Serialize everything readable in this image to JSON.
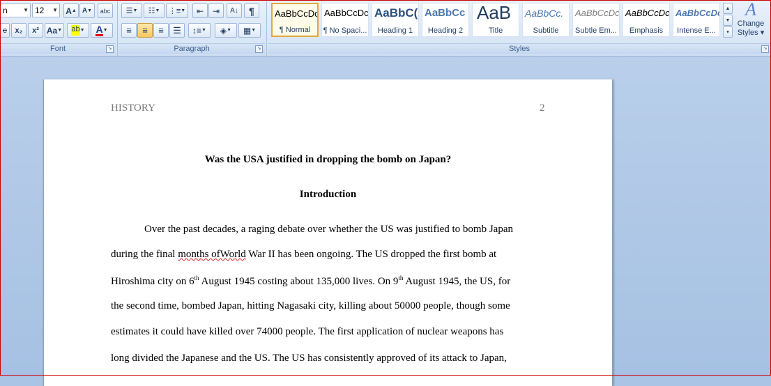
{
  "ribbon": {
    "font_group": {
      "label": "Font",
      "font_name": "n",
      "font_size": "12",
      "buttons": [
        "A",
        "A",
        "abc",
        "x₂",
        "x²",
        "Aa",
        "ab",
        "A"
      ]
    },
    "paragraph_group": {
      "label": "Paragraph",
      "pilcrow": "¶",
      "sort": "A↓"
    },
    "styles_group": {
      "label": "Styles",
      "tiles": [
        {
          "sample": "AaBbCcDc",
          "name": "¶ Normal"
        },
        {
          "sample": "AaBbCcDc",
          "name": "¶ No Spaci..."
        },
        {
          "sample": "AaBbC(",
          "name": "Heading 1"
        },
        {
          "sample": "AaBbCc",
          "name": "Heading 2"
        },
        {
          "sample": "AaB",
          "name": "Title"
        },
        {
          "sample": "AaBbCc.",
          "name": "Subtitle"
        },
        {
          "sample": "AaBbCcDc",
          "name": "Subtle Em..."
        },
        {
          "sample": "AaBbCcDc",
          "name": "Emphasis"
        },
        {
          "sample": "AaBbCcDc",
          "name": "Intense E..."
        }
      ],
      "change_styles_line1": "Change",
      "change_styles_line2": "Styles ▾"
    }
  },
  "document": {
    "header_left": "HISTORY",
    "header_right": "2",
    "title": "Was the USA justified in dropping the bomb on Japan?",
    "heading": "Introduction",
    "lines": {
      "l1": "Over the past decades, a raging debate over whether the US was justified to bomb Japan",
      "l2a": "during the final ",
      "l2b": "months ofWorld",
      "l2c": " War II has been ongoing. The US dropped the first bomb at",
      "l3a": "Hiroshima city on 6",
      "l3sup1": "th",
      "l3b": " August 1945 costing about 135,000 lives. On 9",
      "l3sup2": "th",
      "l3c": " August 1945, the US, for",
      "l4": "the second time, bombed Japan, hitting Nagasaki city, killing about 50000 people, though some",
      "l5": "estimates it could have killed over 74000 people. The first application of nuclear weapons has",
      "l6": "long divided the Japanese and the US. The US has consistently approved of its attack to Japan,"
    }
  }
}
